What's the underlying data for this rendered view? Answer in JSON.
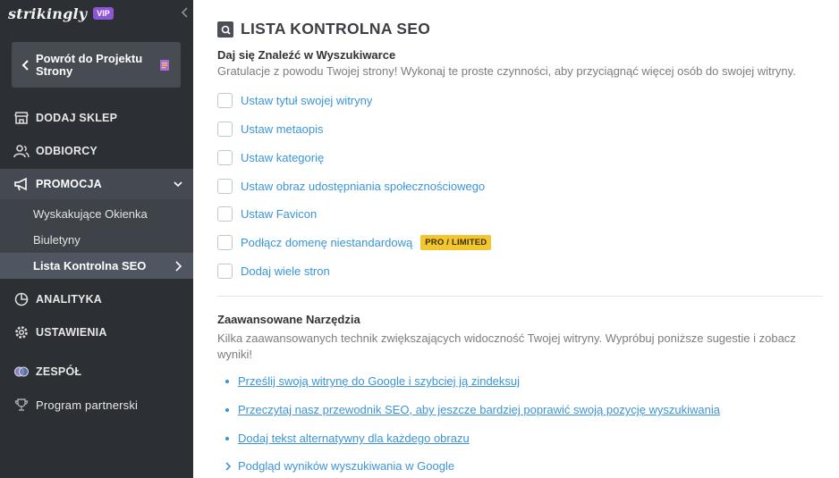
{
  "sidebar": {
    "brand": "strikingly",
    "vip": "VIP",
    "back_label": "Powrót do Projektu Strony",
    "items": [
      {
        "label": "DODAJ SKLEP",
        "icon": "store-icon"
      },
      {
        "label": "ODBIORCY",
        "icon": "audience-icon"
      },
      {
        "label": "PROMOCJA",
        "icon": "megaphone-icon"
      },
      {
        "label": "ANALITYKA",
        "icon": "pie-chart-icon"
      },
      {
        "label": "USTAWIENIA",
        "icon": "gear-icon"
      },
      {
        "label": "ZESPÓŁ",
        "icon": "team-icon"
      },
      {
        "label": "Program partnerski",
        "icon": "trophy-icon"
      }
    ],
    "submenu": [
      {
        "label": "Wyskakujące Okienka"
      },
      {
        "label": "Biuletyny"
      },
      {
        "label": "Lista Kontrolna SEO"
      }
    ]
  },
  "main": {
    "title": "LISTA KONTROLNA SEO",
    "find_section": {
      "title": "Daj się Znaleźć w Wyszukiwarce",
      "desc": "Gratulacje z powodu Twojej strony! Wykonaj te proste czynności, aby przyciągnąć więcej osób do swojej witryny.",
      "items": [
        {
          "label": "Ustaw tytuł swojej witryny"
        },
        {
          "label": "Ustaw metaopis"
        },
        {
          "label": "Ustaw kategorię"
        },
        {
          "label": "Ustaw obraz udostępniania społecznościowego"
        },
        {
          "label": "Ustaw Favicon"
        },
        {
          "label": "Podłącz domenę niestandardową",
          "badge": "PRO / LIMITED"
        },
        {
          "label": "Dodaj wiele stron"
        }
      ]
    },
    "advanced": {
      "title": "Zaawansowane Narzędzia",
      "desc": "Kilka zaawansowanych technik zwiększających widoczność Twojej witryny. Wypróbuj poniższe sugestie i zobacz wyniki!",
      "links": [
        "Prześlij swoją witrynę do Google i szybciej ją zindeksuj",
        "Przeczytaj nasz przewodnik SEO, aby jeszcze bardziej poprawić swoją pozycję wyszukiwania",
        "Dodaj tekst alternatywny dla każdego obrazu"
      ],
      "preview": "Podgląd wyników wyszukiwania w Google"
    }
  },
  "colors": {
    "sidebar_bg": "#2c2f33",
    "accent_link": "#3a95d8",
    "vip_purple": "#8e55d6",
    "badge_yellow": "#f2c531"
  }
}
